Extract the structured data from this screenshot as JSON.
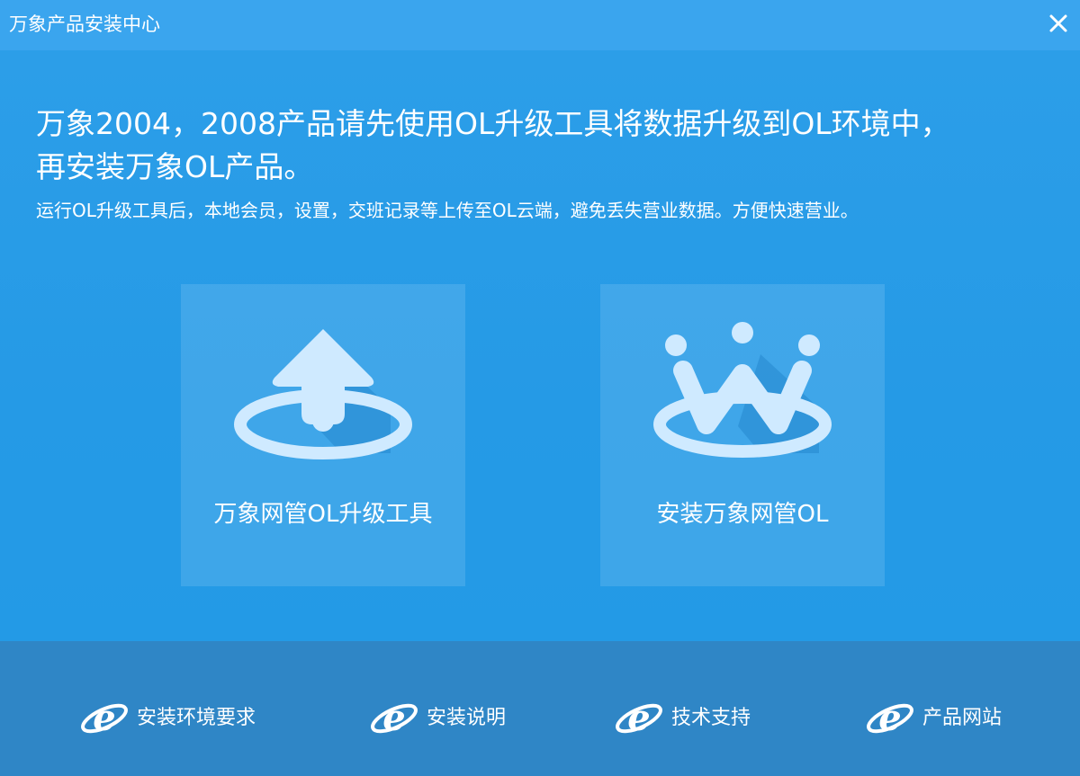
{
  "window": {
    "title": "万象产品安装中心",
    "close_icon": "close-icon"
  },
  "main": {
    "headline_line1": "万象2004，2008产品请先使用OL升级工具将数据升级到OL环境中，",
    "headline_line2": "再安装万象OL产品。",
    "subline": "运行OL升级工具后，本地会员，设置，交班记录等上传至OL云端，避免丢失营业数据。方便快速营业。"
  },
  "cards": [
    {
      "label": "万象网管OL升级工具",
      "icon": "upload-arrow-icon"
    },
    {
      "label": "安装万象网管OL",
      "icon": "wanxiang-logo-icon"
    }
  ],
  "footer": {
    "links": [
      {
        "label": "安装环境要求",
        "icon": "ie-icon"
      },
      {
        "label": "安装说明",
        "icon": "ie-icon"
      },
      {
        "label": "技术支持",
        "icon": "ie-icon"
      },
      {
        "label": "产品网站",
        "icon": "ie-icon"
      }
    ]
  },
  "colors": {
    "background": "#2a9be6",
    "titlebar": "#3aa5ee",
    "footer": "#2f86c6",
    "icon_fill": "#ffffff"
  }
}
